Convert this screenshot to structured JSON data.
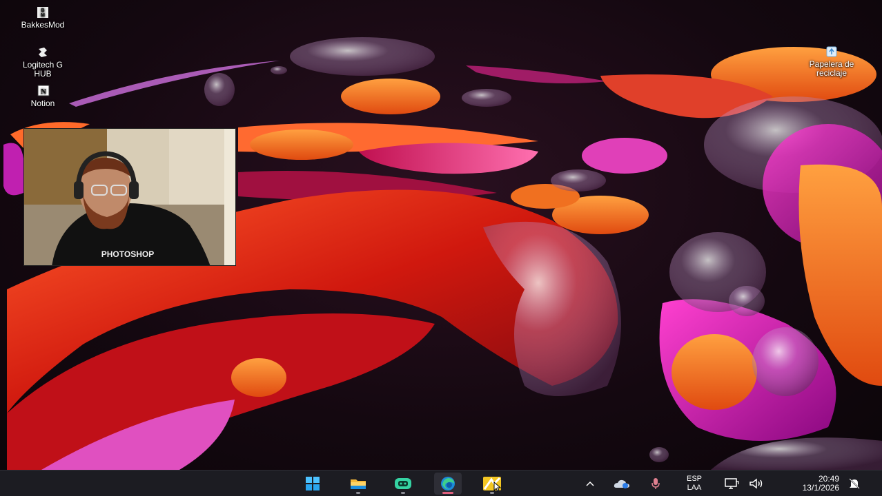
{
  "desktop_icons": [
    {
      "label": "BakkesMod",
      "icon": "bakkesmod-icon"
    },
    {
      "label": "Logitech G\nHUB",
      "icon": "logitech-icon"
    },
    {
      "label": "Notion",
      "icon": "notion-icon"
    },
    {
      "label": "Papelera de\nreciclaje",
      "icon": "recycle-bin-icon"
    }
  ],
  "webcam": {
    "shirt_text": "PHOTOSHOP"
  },
  "taskbar": {
    "apps": [
      {
        "name": "start",
        "icon": "windows-start-icon"
      },
      {
        "name": "file-explorer",
        "icon": "folder-icon"
      },
      {
        "name": "app-green",
        "icon": "green-app-icon"
      },
      {
        "name": "edge",
        "icon": "edge-icon",
        "active": true
      },
      {
        "name": "app-yellow",
        "icon": "yellow-app-icon"
      }
    ],
    "tray": {
      "language_line1": "ESP",
      "language_line2": "LAA",
      "time": "20:49",
      "date": "13/1/2026"
    }
  },
  "colors": {
    "taskbar_bg": "#1c1c22",
    "accent": "#e0607e"
  }
}
